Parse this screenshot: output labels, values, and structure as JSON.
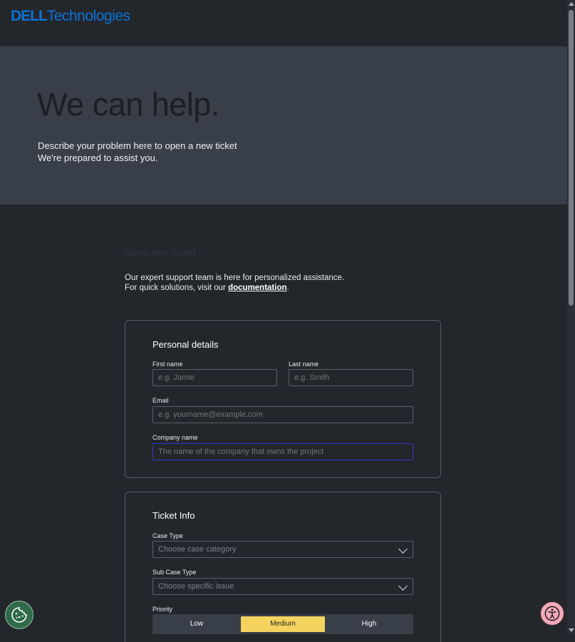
{
  "brand": {
    "logo_main": "DELL",
    "logo_sub": "Technologies"
  },
  "hero": {
    "title": "We can help.",
    "subtitle_line1": "Describe your problem here to open a new ticket",
    "subtitle_line2": "We're prepared to assist you."
  },
  "intro": {
    "title": "Open new ticket",
    "line1": "Our expert support team is here for personalized assistance.",
    "line2_prefix": "For quick solutions, visit our ",
    "link_text": "documentation",
    "line2_suffix": "."
  },
  "personal_details": {
    "title": "Personal details",
    "first_name": {
      "label": "First name",
      "placeholder": "e.g. Jamie",
      "value": ""
    },
    "last_name": {
      "label": "Last name",
      "placeholder": "e.g. Smith",
      "value": ""
    },
    "email": {
      "label": "Email",
      "placeholder": "e.g. yourname@example.com",
      "value": ""
    },
    "company": {
      "label": "Company name",
      "placeholder": "The name of the company that owns the project",
      "value": ""
    }
  },
  "ticket_info": {
    "title": "Ticket Info",
    "case_type": {
      "label": "Case Type",
      "placeholder": "Choose case category"
    },
    "sub_case_type": {
      "label": "Sub Case Type",
      "placeholder": "Choose specific issue"
    },
    "priority": {
      "label": "Priority",
      "options": [
        "Low",
        "Medium",
        "High"
      ],
      "selected": "Medium"
    }
  },
  "colors": {
    "background": "#23262b",
    "hero_background": "#383f49",
    "brand_blue": "#0b73d9",
    "priority_selected": "#f4d35e",
    "cookie_button": "#2f6a4b",
    "accessibility_button": "#f4a9b8",
    "focus_border": "#2b3ec9"
  },
  "icons": {
    "cookie": "cookie-icon",
    "accessibility": "accessibility-icon",
    "dropdown": "chevron-down-icon"
  }
}
